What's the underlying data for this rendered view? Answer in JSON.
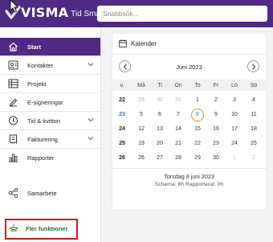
{
  "header": {
    "brand": "VISMA",
    "product": "Tid Smart",
    "search_placeholder": "Snabbsök..."
  },
  "sidebar": {
    "items": [
      {
        "label": "Start",
        "icon": "home-icon",
        "active": true
      },
      {
        "label": "Kontakter",
        "icon": "contacts-icon",
        "chevron": true
      },
      {
        "label": "Projekt",
        "icon": "project-icon"
      },
      {
        "label": "E-signeringar",
        "icon": "signature-icon"
      },
      {
        "label": "Tid & kvitton",
        "icon": "clock-icon",
        "chevron": true
      },
      {
        "label": "Fakturering",
        "icon": "invoice-icon",
        "chevron": true
      },
      {
        "label": "Rapporter",
        "icon": "reports-icon"
      },
      {
        "label": "Samarbete",
        "icon": "share-icon"
      }
    ],
    "more": {
      "label": "Fler funktioner",
      "icon": "more-functions-icon"
    }
  },
  "calendar": {
    "title": "Kalender",
    "month": "Juni 2023",
    "week_header": "v.",
    "weekdays": [
      "Må",
      "Ti",
      "On",
      "To",
      "Fr",
      "Lö",
      "Sö"
    ],
    "weeks": [
      {
        "week": "22",
        "days": [
          "29",
          "30",
          "31",
          "1",
          "2",
          "3",
          "4"
        ]
      },
      {
        "week": "23",
        "days": [
          "5",
          "6",
          "7",
          "8",
          "9",
          "10",
          "11"
        ]
      },
      {
        "week": "24",
        "days": [
          "12",
          "13",
          "14",
          "15",
          "16",
          "17",
          "18"
        ]
      },
      {
        "week": "25",
        "days": [
          "19",
          "20",
          "21",
          "22",
          "23",
          "24",
          "25"
        ]
      },
      {
        "week": "26",
        "days": [
          "26",
          "27",
          "28",
          "29",
          "30",
          "1",
          "2"
        ]
      }
    ],
    "selected_date": "Torsdag 8 juni 2023",
    "summary": "Schema: 8h   Rapporterat: 0h"
  },
  "colors": {
    "brand": "#4e2a84",
    "today_ring": "#e8931e",
    "current_week": "#2b78c5",
    "highlight": "#d6161c"
  }
}
